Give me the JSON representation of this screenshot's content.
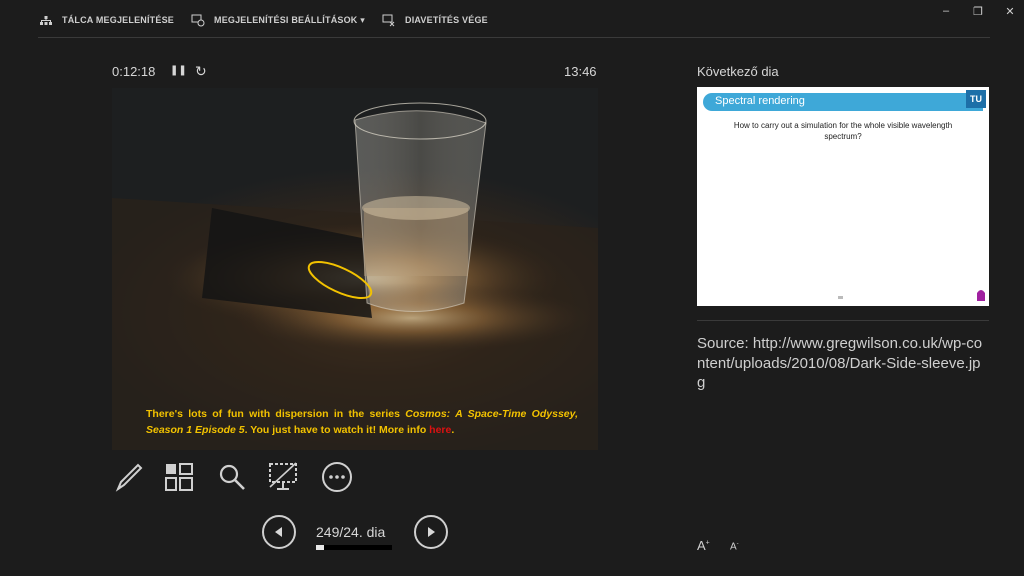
{
  "toolbar": {
    "taskbar_label": "TÁLCA MEGJELENÍTÉSE",
    "display_settings_label": "MEGJELENÍTÉSI BEÁLLÍTÁSOK ▾",
    "end_show_label": "DIAVETÍTÉS VÉGE"
  },
  "window": {
    "minimize": "–",
    "restore": "❐",
    "close": "✕"
  },
  "timer": {
    "elapsed": "0:12:18",
    "pause_glyph": "❚❚",
    "reset_glyph": "↻",
    "clock": "13:46"
  },
  "slide": {
    "caption_part1": "There's lots of fun with dispersion in the series ",
    "caption_italic": "Cosmos: A Space-Time Odyssey, Season 1 Episode 5",
    "caption_part2": ". You just have to watch it! More info ",
    "caption_link": "here",
    "caption_end": "."
  },
  "nav": {
    "slide_count": "249/24. dia",
    "progress_fraction": 0.1
  },
  "next": {
    "label": "Következő dia",
    "title": "Spectral rendering",
    "body": "How to carry out a simulation for the whole visible wavelength spectrum?",
    "logo_text": "TU"
  },
  "notes": {
    "text": "Source: http://www.gregwilson.co.uk/wp-content/uploads/2010/08/Dark-Side-sleeve.jpg"
  },
  "font": {
    "increase": "A",
    "decrease": "A"
  },
  "colors": {
    "accent_blue": "#3ea8d8",
    "caption_yellow": "#f2c200",
    "link_red": "#dd1111",
    "background": "#1c1c1c"
  }
}
